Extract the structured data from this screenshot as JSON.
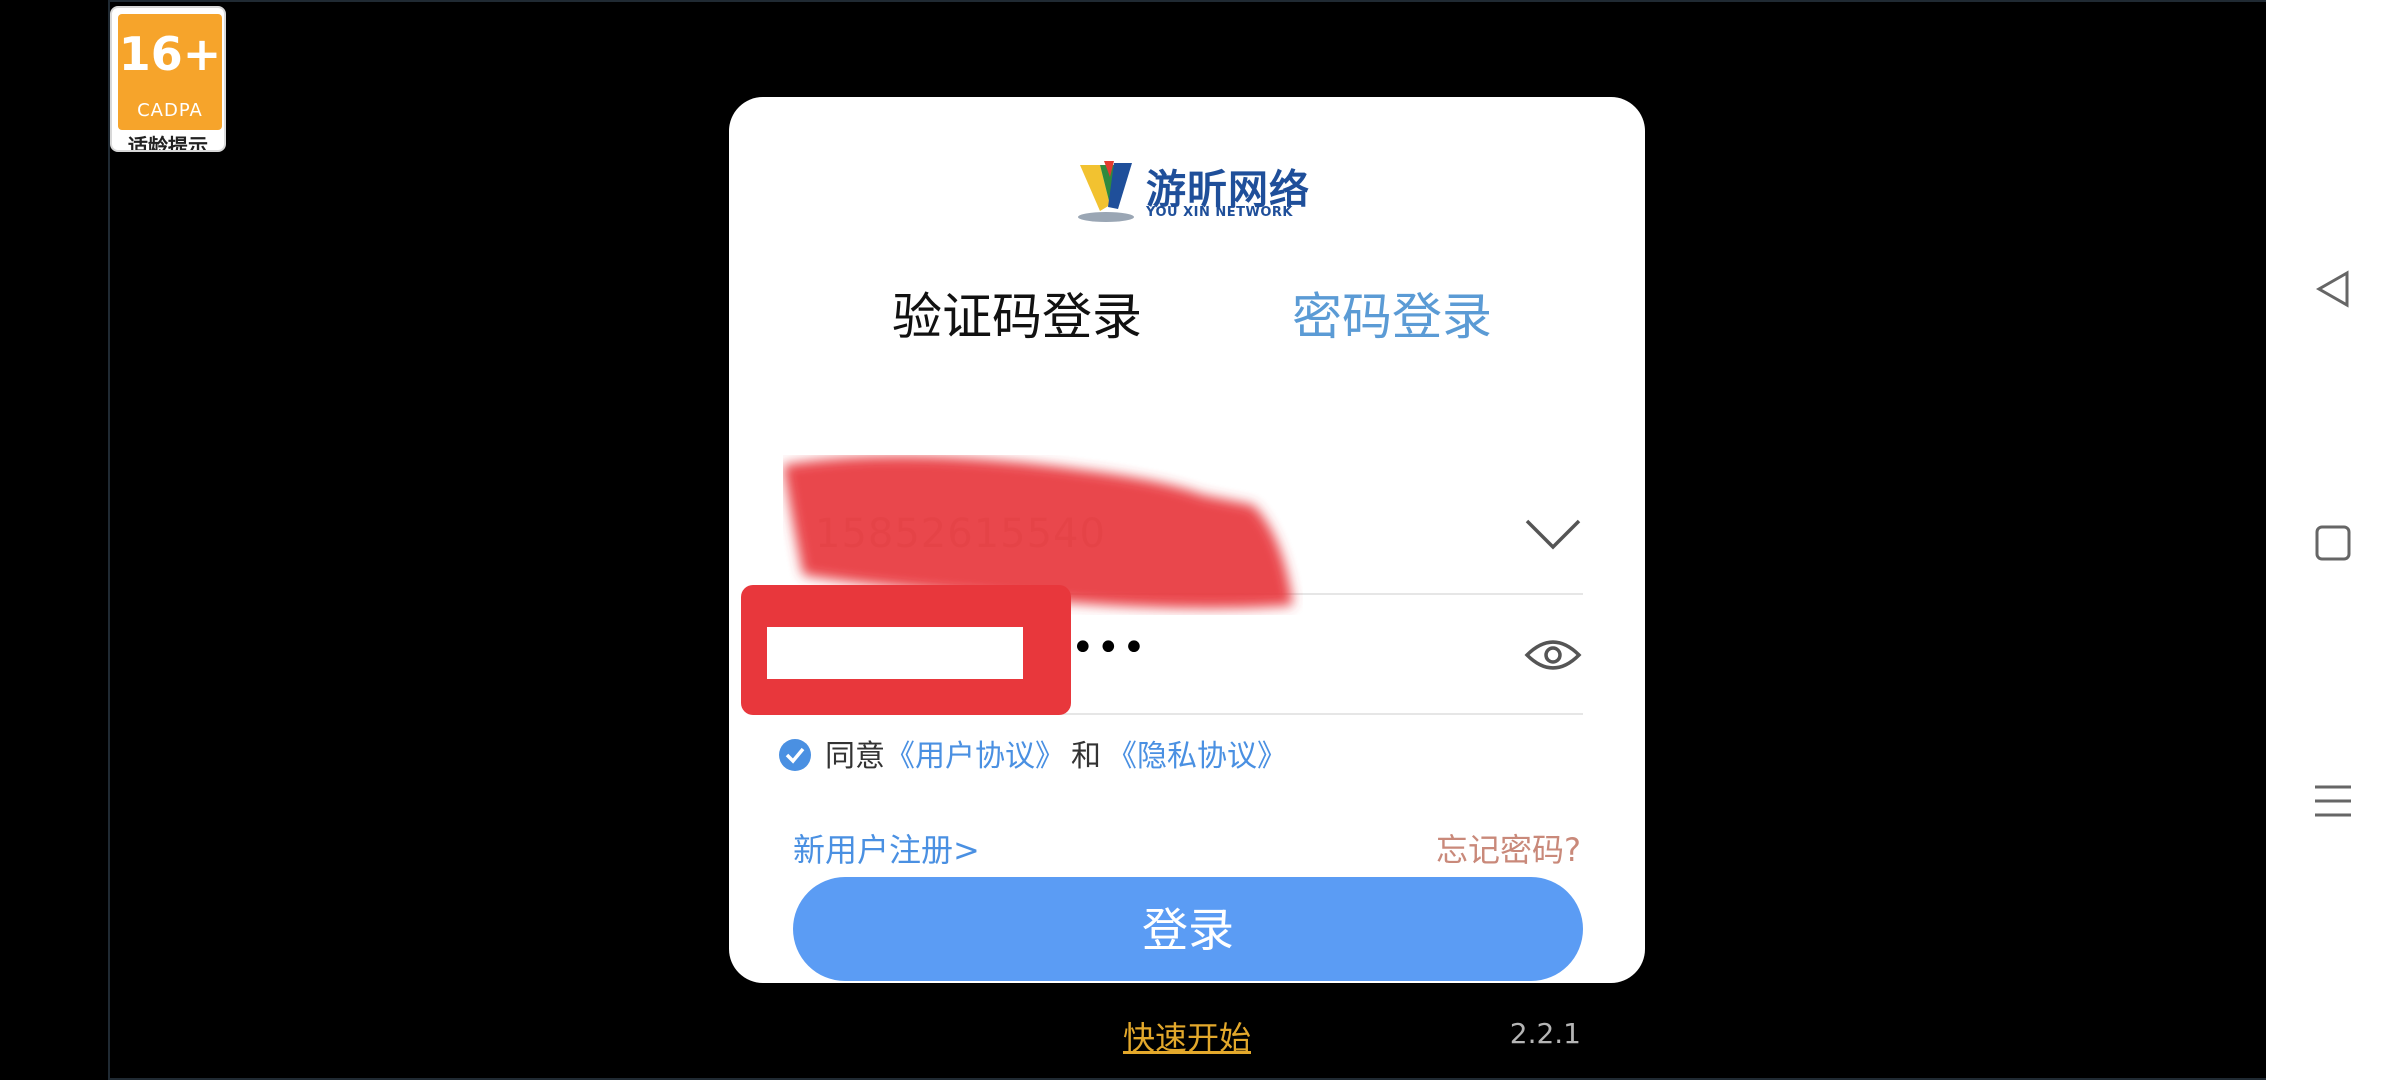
{
  "age_badge": {
    "age": "16+",
    "org": "CADPA",
    "label": "适龄提示"
  },
  "logo": {
    "name": "游昕网络",
    "subtitle": "YOU XIN NETWORK"
  },
  "tabs": [
    {
      "label": "验证码登录",
      "active": true
    },
    {
      "label": "密码登录",
      "active": false
    }
  ],
  "phone_field": {
    "value": "15852615540",
    "icon": "chevron-down-icon"
  },
  "password_field": {
    "value": "•••••••••••••",
    "icon": "eye-icon"
  },
  "agreement": {
    "prefix": "同意",
    "user_agreement": "《用户协议》",
    "and": "和",
    "privacy_policy": "《隐私协议》"
  },
  "links": {
    "register": "新用户注册>",
    "forgot": "忘记密码?"
  },
  "login_button": "登录",
  "quick_start": "快速开始",
  "version": "2.2.1",
  "colors": {
    "accent": "#5b9cf4",
    "link": "#4a90e2",
    "forgot": "#c9897a",
    "quick": "#e3a82b",
    "highlight": "#e8373c"
  },
  "nav": {
    "back_icon": "back-triangle-icon",
    "home_icon": "home-square-icon",
    "menu_icon": "menu-lines-icon"
  }
}
